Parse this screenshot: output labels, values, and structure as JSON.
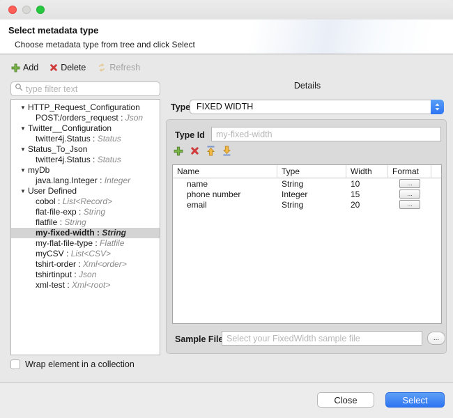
{
  "header": {
    "title": "Select metadata type",
    "subtitle": "Choose metadata type from tree and click Select"
  },
  "toolbar": {
    "add": "Add",
    "delete": "Delete",
    "refresh": "Refresh"
  },
  "filter": {
    "placeholder": "type filter text"
  },
  "tree": {
    "separator": " : ",
    "items": [
      {
        "name": "HTTP_Request_Configuration",
        "parent": true
      },
      {
        "name": "POST:/orders_request",
        "type": "Json"
      },
      {
        "name": "Twitter__Configuration",
        "parent": true
      },
      {
        "name": "twitter4j.Status",
        "type": "Status"
      },
      {
        "name": "Status_To_Json",
        "parent": true
      },
      {
        "name": "twitter4j.Status",
        "type": "Status"
      },
      {
        "name": "myDb",
        "parent": true
      },
      {
        "name": "java.lang.Integer",
        "type": "Integer"
      },
      {
        "name": "User Defined",
        "parent": true
      },
      {
        "name": "cobol",
        "type": "List<Record>"
      },
      {
        "name": "flat-file-exp",
        "type": "String"
      },
      {
        "name": "flatfile",
        "type": "String"
      },
      {
        "name": "my-fixed-width",
        "type": "String",
        "selected": true
      },
      {
        "name": "my-flat-file-type",
        "type": "Flatfile"
      },
      {
        "name": "myCSV",
        "type": "List<CSV>"
      },
      {
        "name": "tshirt-order",
        "type": "Xml<order>"
      },
      {
        "name": "tshirtinput",
        "type": "Json"
      },
      {
        "name": "xml-test",
        "type": "Xml<root>"
      }
    ]
  },
  "details": {
    "title": "Details",
    "type_label": "Type",
    "type_value": "FIXED WIDTH",
    "type_id_label": "Type Id",
    "type_id_placeholder": "my-fixed-width",
    "table": {
      "headers": [
        "Name",
        "Type",
        "Width",
        "Format"
      ],
      "format_button_label": "...",
      "rows": [
        {
          "name": "name",
          "type": "String",
          "width": "10"
        },
        {
          "name": "phone number",
          "type": "Integer",
          "width": "15"
        },
        {
          "name": "email",
          "type": "String",
          "width": "20"
        }
      ]
    },
    "sample_file_label": "Sample File",
    "sample_file_placeholder": "Select your FixedWidth sample file",
    "browse_button_label": "..."
  },
  "checkbox": {
    "label": "Wrap element in a collection",
    "checked": false
  },
  "footer": {
    "close": "Close",
    "select": "Select"
  },
  "icons": {
    "expanded": "▼"
  },
  "colors": {
    "accent_blue": "#3478f4",
    "add_green": "#7ab648",
    "delete_red": "#cf3c3c",
    "arrow_gold": "#f2b844"
  }
}
